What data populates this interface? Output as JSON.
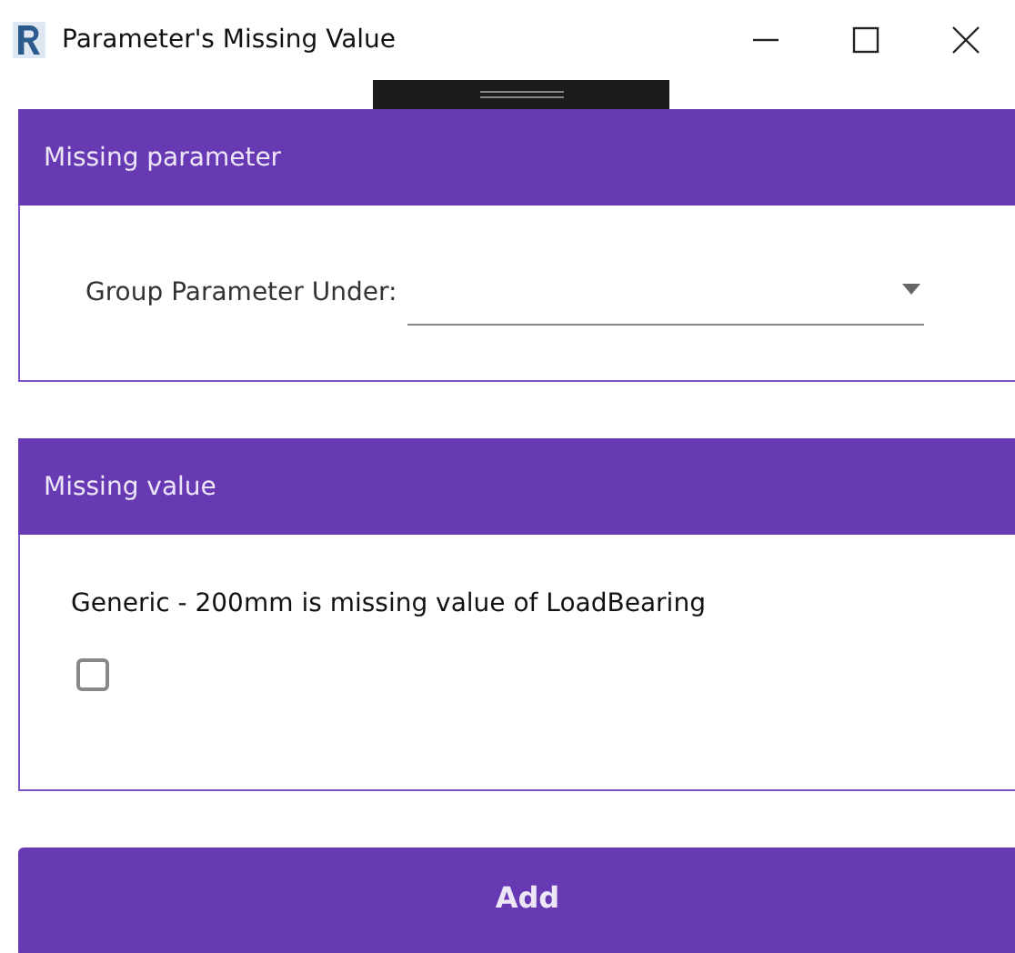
{
  "window": {
    "title": "Parameter's Missing Value"
  },
  "sections": [
    {
      "title": "Missing parameter",
      "kind": "dropdown",
      "label": "Group Parameter Under:"
    },
    {
      "title": "Missing value",
      "kind": "checkbox",
      "label": "Generic - 200mm is missing value of LoadBearing",
      "checked": false
    }
  ],
  "buttons": [
    "Add"
  ]
}
